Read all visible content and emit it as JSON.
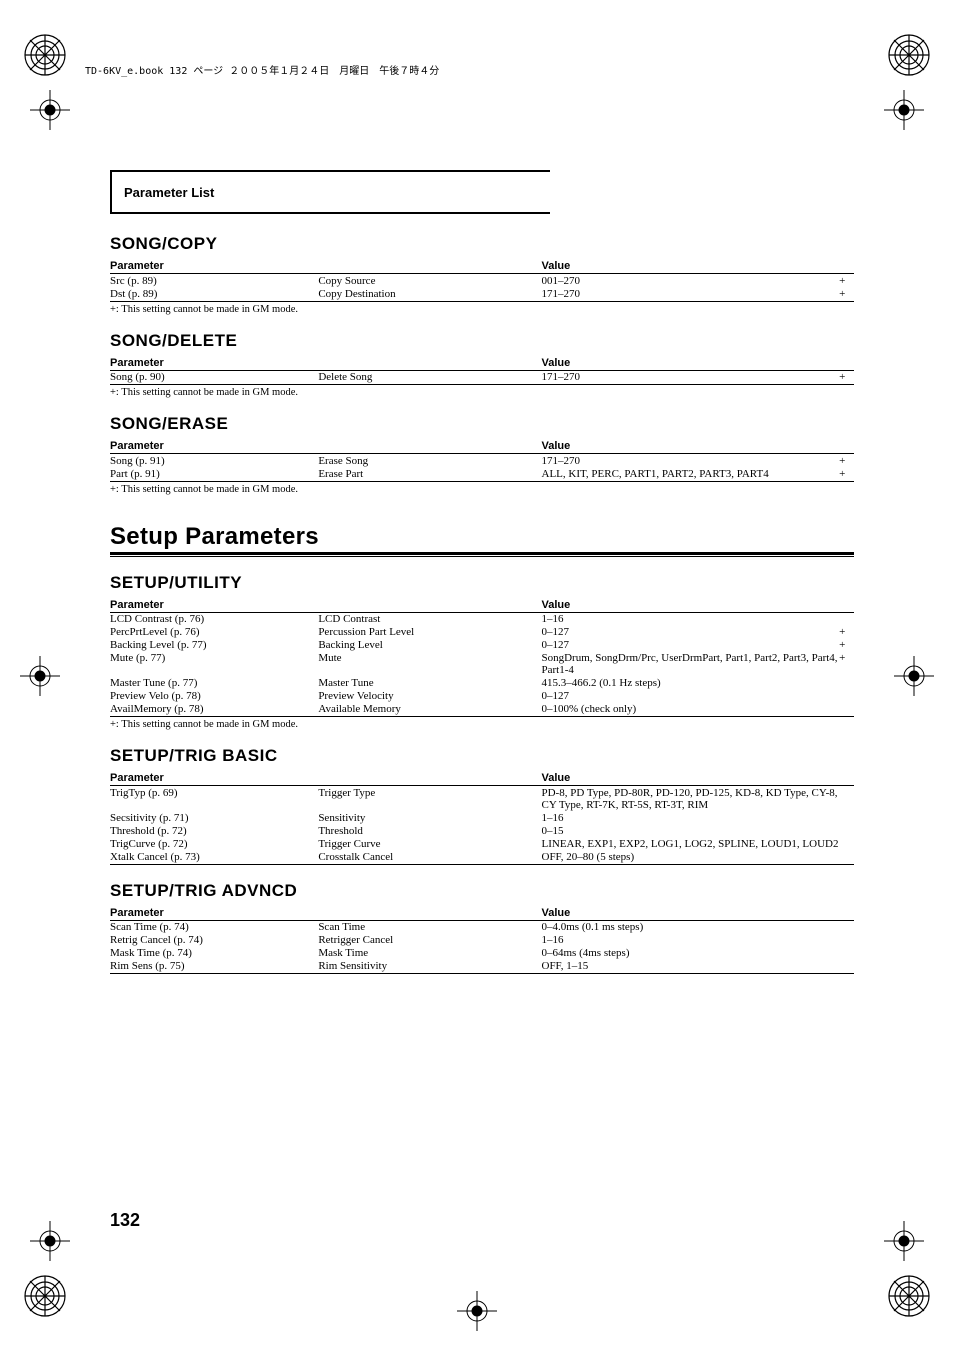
{
  "header_text": "TD-6KV_e.book 132 ページ ２００５年１月２４日　月曜日　午後７時４分",
  "title_box": "Parameter List",
  "footnote": "+:   This setting cannot be made in GM mode.",
  "page_number": "132",
  "th_param": "Parameter",
  "th_value": "Value",
  "sections": {
    "song_copy": {
      "title": "SONG/COPY",
      "rows": [
        {
          "p": "Src (p. 89)",
          "d": "Copy Source",
          "v": "001–270",
          "m": "+"
        },
        {
          "p": "Dst (p. 89)",
          "d": "Copy Destination",
          "v": "171–270",
          "m": "+"
        }
      ]
    },
    "song_delete": {
      "title": "SONG/DELETE",
      "rows": [
        {
          "p": "Song (p. 90)",
          "d": "Delete Song",
          "v": "171–270",
          "m": "+"
        }
      ]
    },
    "song_erase": {
      "title": "SONG/ERASE",
      "rows": [
        {
          "p": "Song (p. 91)",
          "d": "Erase Song",
          "v": "171–270",
          "m": "+"
        },
        {
          "p": "Part (p. 91)",
          "d": "Erase Part",
          "v": "ALL, KIT, PERC, PART1, PART2, PART3, PART4",
          "m": "+"
        }
      ]
    },
    "setup": {
      "title": "Setup Parameters"
    },
    "setup_utility": {
      "title": "SETUP/UTILITY",
      "rows": [
        {
          "p": "LCD Contrast (p. 76)",
          "d": "LCD Contrast",
          "v": "1–16",
          "m": ""
        },
        {
          "p": "PercPrtLevel (p. 76)",
          "d": "Percussion Part Level",
          "v": "0–127",
          "m": "+"
        },
        {
          "p": "Backing Level (p. 77)",
          "d": "Backing Level",
          "v": "0–127",
          "m": "+"
        },
        {
          "p": "Mute (p. 77)",
          "d": "Mute",
          "v": "SongDrum, SongDrm/Prc, UserDrmPart, Part1, Part2, Part3, Part4, Part1-4",
          "m": "+"
        },
        {
          "p": "Master Tune (p. 77)",
          "d": "Master Tune",
          "v": "415.3–466.2 (0.1 Hz steps)",
          "m": ""
        },
        {
          "p": "Preview Velo (p. 78)",
          "d": "Preview Velocity",
          "v": "0–127",
          "m": ""
        },
        {
          "p": "AvailMemory (p. 78)",
          "d": "Available Memory",
          "v": "0–100% (check only)",
          "m": ""
        }
      ]
    },
    "setup_trig_basic": {
      "title": "SETUP/TRIG BASIC",
      "rows": [
        {
          "p": "TrigTyp (p. 69)",
          "d": "Trigger Type",
          "v": "PD-8, PD Type, PD-80R, PD-120, PD-125, KD-8, KD Type, CY-8, CY Type, RT-7K, RT-5S, RT-3T, RIM",
          "m": ""
        },
        {
          "p": "Secsitivity (p. 71)",
          "d": "Sensitivity",
          "v": "1–16",
          "m": ""
        },
        {
          "p": "Threshold (p. 72)",
          "d": "Threshold",
          "v": "0–15",
          "m": ""
        },
        {
          "p": "TrigCurve (p. 72)",
          "d": "Trigger Curve",
          "v": "LINEAR, EXP1, EXP2, LOG1, LOG2, SPLINE, LOUD1, LOUD2",
          "m": ""
        },
        {
          "p": "Xtalk Cancel (p. 73)",
          "d": "Crosstalk Cancel",
          "v": "OFF, 20–80 (5 steps)",
          "m": ""
        }
      ]
    },
    "setup_trig_advncd": {
      "title": "SETUP/TRIG ADVNCD",
      "rows": [
        {
          "p": "Scan Time (p. 74)",
          "d": "Scan Time",
          "v": "0–4.0ms (0.1 ms steps)",
          "m": ""
        },
        {
          "p": "Retrig Cancel (p. 74)",
          "d": "Retrigger Cancel",
          "v": "1–16",
          "m": ""
        },
        {
          "p": "Mask Time (p. 74)",
          "d": "Mask Time",
          "v": "0–64ms (4ms steps)",
          "m": ""
        },
        {
          "p": "Rim Sens (p. 75)",
          "d": "Rim Sensitivity",
          "v": "OFF, 1–15",
          "m": ""
        }
      ]
    }
  }
}
